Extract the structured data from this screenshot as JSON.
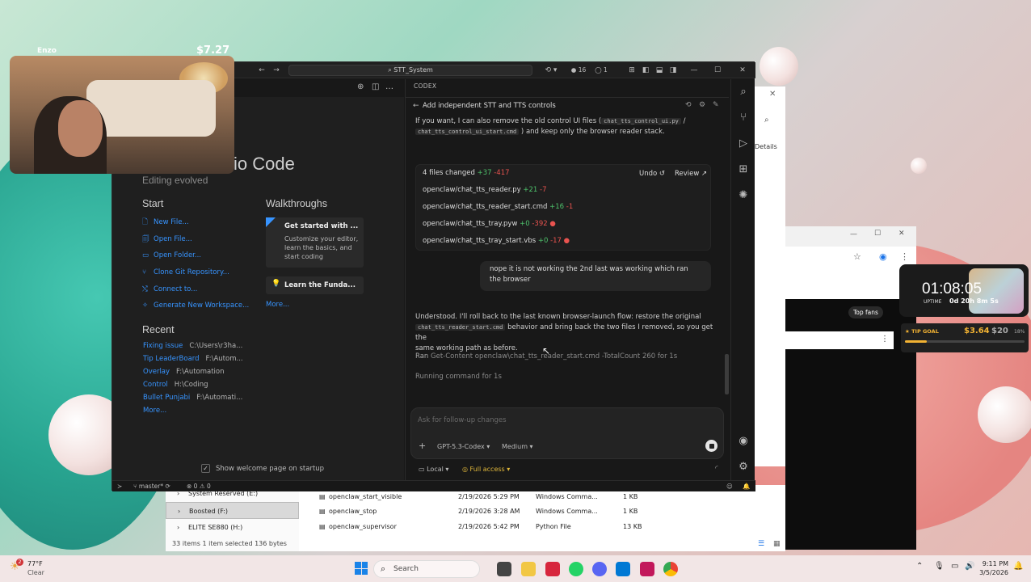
{
  "overlay": {
    "username": "Enzo",
    "amount_top": "$7.27"
  },
  "vscode": {
    "search_text": "STT_System",
    "badge_count": "16",
    "badge_count2": "1",
    "editor": {
      "title": "io Code",
      "subtitle": "Editing evolved",
      "start_heading": "Start",
      "start_items": [
        "New File...",
        "Open File...",
        "Open Folder...",
        "Clone Git Repository...",
        "Connect to...",
        "Generate New Workspace..."
      ],
      "walkthroughs_heading": "Walkthroughs",
      "walk1_title": "Get started with ...",
      "walk1_desc": "Customize your editor, learn the basics, and start coding",
      "walk2_title": "Learn the Funda...",
      "more": "More...",
      "recent_heading": "Recent",
      "recent": [
        {
          "name": "Fixing issue",
          "path": "C:\\Users\\r3ha..."
        },
        {
          "name": "Tip LeaderBoard",
          "path": "F:\\Autom..."
        },
        {
          "name": "Overlay",
          "path": "F:\\Automation"
        },
        {
          "name": "Control",
          "path": "H:\\Coding"
        },
        {
          "name": "Bullet Punjabi",
          "path": "F:\\Automati..."
        }
      ],
      "recent_more": "More...",
      "show_welcome": "Show welcome page on startup"
    },
    "status": {
      "branch": "master*",
      "errors": "0",
      "warnings": "0"
    },
    "codex": {
      "header": "CODEX",
      "task": "Add independent STT and TTS controls",
      "msg1_a": "If you want, I can also remove the old control UI files (",
      "msg1_code1": "chat_tts_control_ui.py",
      "msg1_sep": " / ",
      "msg1_code2": "chat_tts_control_ui_start.cmd",
      "msg1_b": ") and keep only the browser reader stack.",
      "files_summary": "4 files changed",
      "files_add": "+37",
      "files_del": "-417",
      "undo": "Undo",
      "review": "Review",
      "files": [
        {
          "name": "openclaw/chat_tts_reader.py",
          "add": "+21",
          "del": "-7",
          "dot": ""
        },
        {
          "name": "openclaw/chat_tts_reader_start.cmd",
          "add": "+16",
          "del": "-1",
          "dot": ""
        },
        {
          "name": "openclaw/chat_tts_tray.pyw",
          "add": "+0",
          "del": "-392",
          "dot": "●"
        },
        {
          "name": "openclaw/chat_tts_tray_start.vbs",
          "add": "+0",
          "del": "-17",
          "dot": "●"
        }
      ],
      "user_msg": "nope it is not working the 2nd last was working which ran the browser",
      "reply_a": "Understood. I'll roll back to the last known browser-launch flow: restore the original",
      "reply_code": "chat_tts_reader_start.cmd",
      "reply_b": "behavior and bring back the two files I removed, so you get the",
      "reply_c": "same working path as before.",
      "ran_label": "Ran",
      "ran_cmd": "Get-Content openclaw\\chat_tts_reader_start.cmd -TotalCount 260 for 1s",
      "running_label": "Running command",
      "running_time": "for 1s",
      "input_placeholder": "Ask for follow-up changes",
      "model": "GPT-5.3-Codex",
      "effort": "Medium",
      "env": "Local",
      "access": "Full access"
    }
  },
  "explorer": {
    "drives": [
      "System Reserved (E:)",
      "Boosted (F:)",
      "ELITE SE880 (H:)"
    ],
    "files": [
      {
        "name": "openclaw_start_visible",
        "date": "2/19/2026 5:29 PM",
        "type": "Windows Comma...",
        "size": "1 KB"
      },
      {
        "name": "openclaw_stop",
        "date": "2/19/2026 3:28 AM",
        "type": "Windows Comma...",
        "size": "1 KB"
      },
      {
        "name": "openclaw_supervisor",
        "date": "2/19/2026 5:42 PM",
        "type": "Python File",
        "size": "13 KB"
      }
    ],
    "status": "33 items     1 item selected  136 bytes"
  },
  "browser": {
    "top_fans": "Top fans",
    "details": "Details"
  },
  "timer": {
    "value": "01:08:05",
    "uptime_label": "UPTIME",
    "uptime_val": "0d 20h 8m 5s"
  },
  "tip": {
    "label": "TIP GOAL",
    "current": "$3.64",
    "goal": "$20",
    "pct": "18%",
    "progress": 0.18
  },
  "taskbar": {
    "weather_temp": "77°F",
    "weather_cond": "Clear",
    "weather_badge": "2",
    "search": "Search",
    "time": "9:11 PM",
    "date": "3/5/2026"
  }
}
